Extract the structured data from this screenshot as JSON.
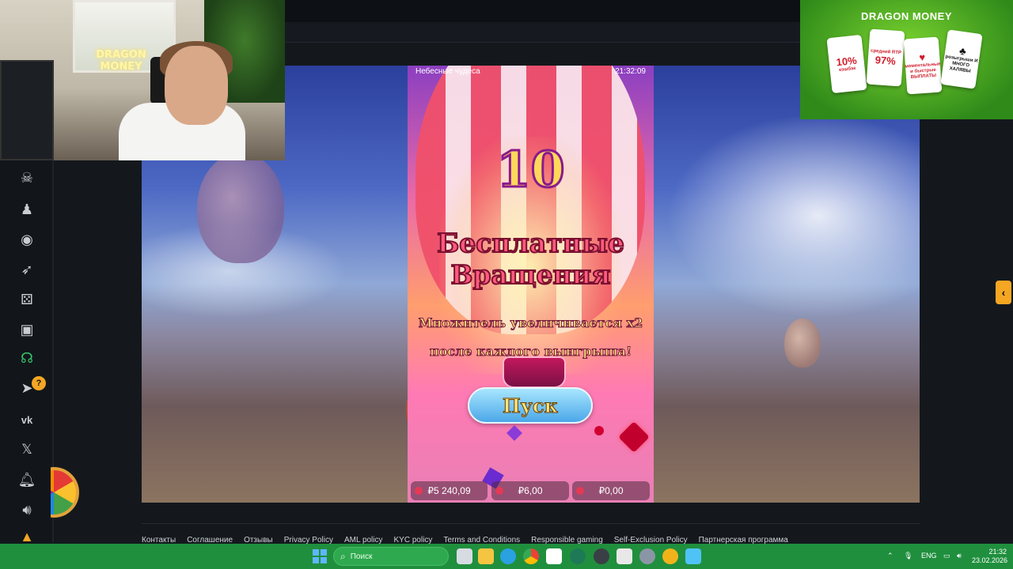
{
  "game": {
    "title": "Небесные чудеса",
    "clock": "21:32:09",
    "free_spins_count": "10",
    "headline_line1": "Бесплатные",
    "headline_line2": "Вращения",
    "sub_line1": "Множитель увеличивается x2",
    "sub_line2": "после каждого выигрыша!",
    "start_button": "Пуск",
    "balance": "₽5 240,09",
    "bet": "₽6,00",
    "win": "₽0,00"
  },
  "webcam": {
    "neon_sign_line1": "DRAGON",
    "neon_sign_line2": "MONEY"
  },
  "banner": {
    "title": "DRAGON MONEY",
    "cards": [
      {
        "big": "10%",
        "small": "кэшбэк"
      },
      {
        "big": "97%",
        "small": "средний RTP"
      },
      {
        "big": "♥",
        "small": "моментальные и быстрые ВЫПЛАТЫ"
      },
      {
        "big": "♣",
        "small": "розыгрыши И МНОГО ХАЛЯВЫ"
      }
    ]
  },
  "sidebar": {
    "icons": [
      "dragon-icon",
      "user-icon",
      "roulette-icon",
      "rocket-icon",
      "dice-icon",
      "slot-machine-icon",
      "support-icon",
      "telegram-icon",
      "vk-icon",
      "x-icon",
      "bell-icon",
      "sound-icon",
      "bonus-icon"
    ],
    "badge": "?"
  },
  "footer": {
    "links": [
      "Контакты",
      "Соглашение",
      "Отзывы",
      "Privacy Policy",
      "AML policy",
      "KYC policy",
      "Terms and Conditions",
      "Responsible gaming",
      "Self-Exclusion Policy",
      "Партнерская программа"
    ]
  },
  "taskbar": {
    "search_placeholder": "Поиск",
    "language": "ENG",
    "time": "21:32",
    "date": "23.02.2026"
  }
}
